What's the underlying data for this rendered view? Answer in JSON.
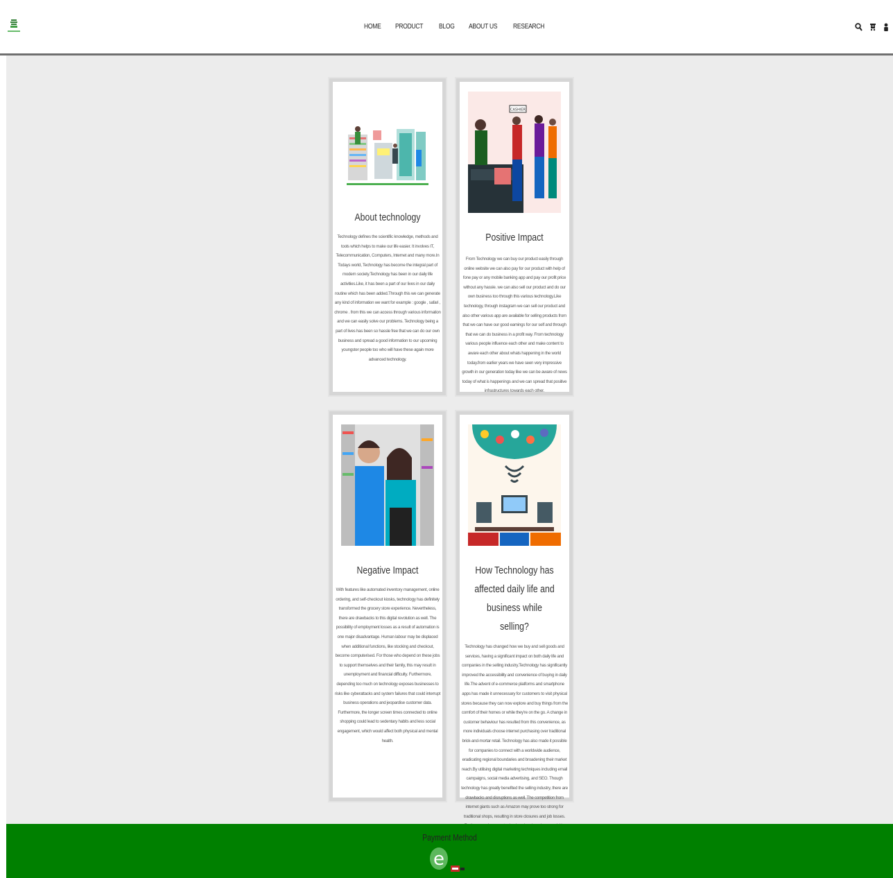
{
  "nav": {
    "items": [
      "HOME",
      "PRODUCT",
      "BLOG",
      "ABOUT US",
      "RESEARCH"
    ]
  },
  "header_icons": [
    "search-icon",
    "cart-icon",
    "user-icon"
  ],
  "cards": [
    {
      "title": "About technology",
      "text": "Technology defines the scientific knowledge, methods and tools which helps to make our life easier. It involves IT, Telecommunication, Computers, Internet and many more.In Todays world, Technology has become the integral part of modern society.Technology has been in our daily life activities.Like, it has been a part of our lives in our daily routine which has been added.Through this we can generate any kind of information we want for example : google , safari , chrome . from this we can access through various information and we can easily solve our problems. Technology being a part of lives has been so hassle free that we can do our own business and spread a good information to our upcoming youngster people too who will have these again more advanced technology."
    },
    {
      "title": "Positive Impact",
      "image_label": "CASHIER",
      "text": "From Technology we can buy our product easily through online website we can also pay for our product with help of fone pay or any mobile banking app and pay our profit price without any hassle. we can also sell our product and do our own business too through this various technology.Like technology, through instagram we can sell our product and also other various app are available for selling products from that we can have our good earnings for our self and through that we can do business in a profit way. From technology various people influence each other and make content to aware each other about whats happening in the world today.from earlier years we have seen very impressive growth in our generation today like we can be aware of news today of what is happenings and we can spread that positive infrastructures towards each other."
    },
    {
      "title": "Negative Impact",
      "text": "With features like automated inventory management, online ordering, and self-checkout kiosks, technology has definitely transformed the grocery store experience. Nevertheless, there are drawbacks to this digital revolution as well. The possibility of employment losses as a result of automation is one major disadvantage. Human labour may be displaced when additional functions, like stocking and checkout, become computerised. For those who depend on these jobs to support themselves and their family, this may result in unemployment and financial difficulty. Furthermore, depending too much on technology exposes businesses to risks like cyberattacks and system failures that could interrupt business operations and jeopardise customer data. Furthermore, the longer screen times connected to online shopping could lead to sedentary habits and less social engagement, which would affect both physical and mental health."
    },
    {
      "title": "How Technology has affected daily life and business while selling?",
      "text": "Technology has changed how we buy and sell goods and services, having a significant impact on both daily life and companies in the selling industry.Technology has significantly improved the accessibility and convenience of buying in daily life.The advent of e-commerce platforms and smartphone apps has made it unnecessary for customers to visit physical stores because they can now explore and buy things from the comfort of their homes or while they're on the go. A change in customer behaviour has resulted from this convenience, as more individuals choose internet purchasing over traditional brick-and-mortar retail. Technology has also made it possible for companies to connect with a worldwide audience, eradicating regional boundaries and broadening their market reach.By utilising digital marketing techniques including email campaigns, social media advertising, and SEO. Though technology has greatly benefited the selling industry, there are drawbacks and disruptions as well. The competition from internet giants such as Amazon may prove too strong for traditional shops, resulting in store closures and job losses. Furthermore, because technology is advancing so quickly, companies must constantly adapt and make time- and money-consuming investments in new infrastructure and tools."
    }
  ],
  "footer": {
    "payment_label": "Payment Method",
    "brand_color": "#008000"
  }
}
